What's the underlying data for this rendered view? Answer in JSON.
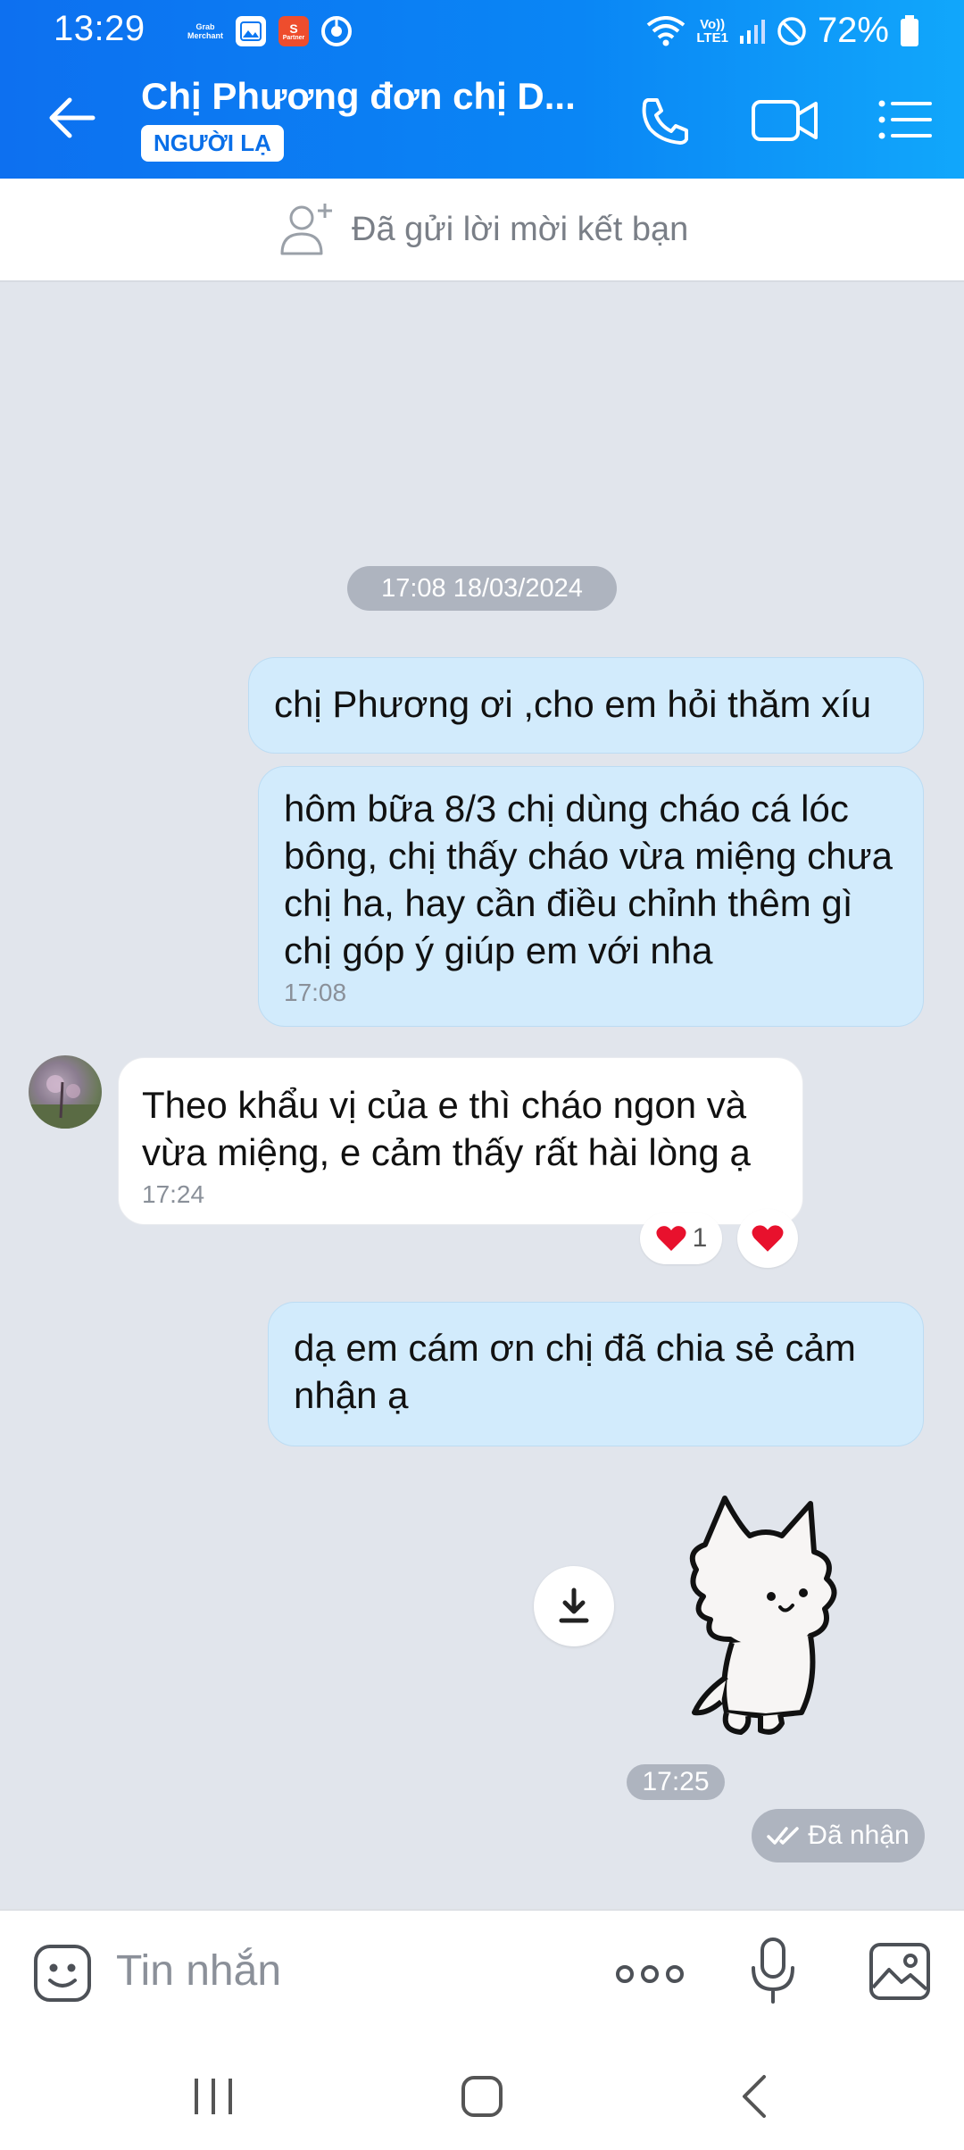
{
  "status_bar": {
    "time": "13:29",
    "app_icons": [
      "grab-merchant-icon",
      "gallery-icon",
      "shopee-partner-icon",
      "chrome-icon"
    ],
    "grab_label": "Grab Merchant",
    "shopee_label": "Partner",
    "network_label_1": "Vo))",
    "network_label_2": "LTE1",
    "battery": "72%"
  },
  "header": {
    "contact_name": "Chị Phương đơn chị D...",
    "badge": "NGƯỜI LẠ"
  },
  "friend_bar": {
    "text": "Đã gửi lời mời kết bạn"
  },
  "chat": {
    "date_stamp": "17:08 18/03/2024",
    "messages": [
      {
        "from": "me",
        "text": "chị Phương ơi ,cho em hỏi thăm xíu",
        "time": ""
      },
      {
        "from": "me",
        "text": "hôm bữa 8/3 chị dùng cháo cá lóc bông, chị thấy cháo vừa miệng chưa chị ha, hay cần điều chỉnh thêm gì chị góp ý giúp em với nha",
        "time": "17:08"
      },
      {
        "from": "them",
        "text": "Theo khẩu vị của e thì cháo ngon và vừa miệng, e cảm thấy rất hài lòng ạ",
        "time": "17:24"
      },
      {
        "from": "me",
        "text": "dạ em cám ơn chị đã chia sẻ cảm nhận ạ",
        "time": ""
      }
    ],
    "reaction_count": "1",
    "sticker_time": "17:25",
    "delivery_status": "Đã nhận"
  },
  "composer": {
    "placeholder": "Tin nhắn"
  },
  "colors": {
    "header_start": "#0d70f0",
    "header_end": "#11a7fb",
    "my_bubble": "#d2ebfc",
    "their_bubble": "#ffffff",
    "chat_bg": "#e1e5ec",
    "heart": "#e8112d"
  }
}
